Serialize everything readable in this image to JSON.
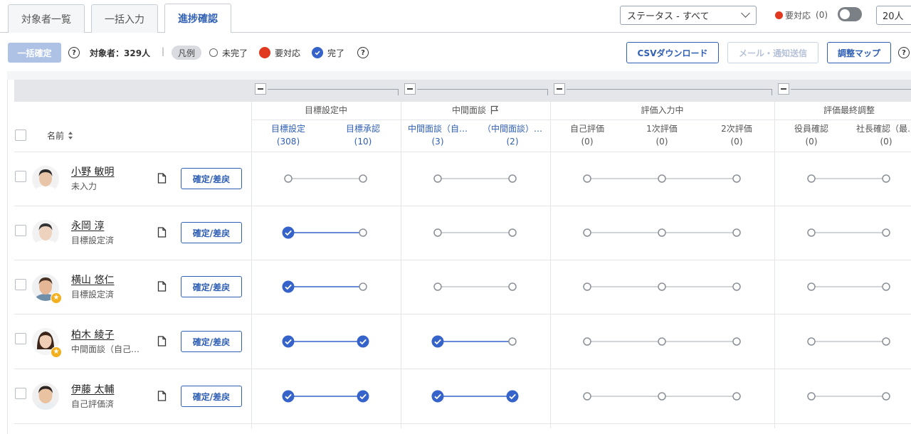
{
  "tabs": [
    {
      "label": "対象者一覧",
      "active": false
    },
    {
      "label": "一括入力",
      "active": false
    },
    {
      "label": "進捗確認",
      "active": true
    }
  ],
  "filters": {
    "status_select": "ステータス - すべて",
    "alert_label": "要対応",
    "alert_count": "(0)",
    "alert_toggle_on": false,
    "per_page": "20人"
  },
  "toolbar": {
    "bulk_confirm_label": "一括確定",
    "target_count": "対象者：329人",
    "separator": "|",
    "legend_label": "凡例",
    "legend_incomplete": "未完了",
    "legend_action": "要対応",
    "legend_done": "完了",
    "csv_label": "CSVダウンロード",
    "mail_label": "メール・通知送信",
    "adjust_map_label": "調整マップ",
    "help_glyph": "?"
  },
  "table": {
    "name_header": "名前",
    "groups": [
      {
        "label": "目標設定中",
        "flag": false
      },
      {
        "label": "中間面談",
        "flag": true
      },
      {
        "label": "評価入力中",
        "flag": false
      },
      {
        "label": "評価最終調整",
        "flag": false
      }
    ],
    "stages": [
      {
        "label": "目標設定",
        "count": "(308)",
        "link": true
      },
      {
        "label": "目標承認",
        "count": "(10)",
        "link": true
      },
      {
        "label": "中間面談（自…",
        "count": "(3)",
        "link": true
      },
      {
        "label": "（中間面談）…",
        "count": "(2)",
        "link": true
      },
      {
        "label": "自己評価",
        "count": "(0)",
        "link": false
      },
      {
        "label": "1次評価",
        "count": "(0)",
        "link": false
      },
      {
        "label": "2次評価",
        "count": "(0)",
        "link": false
      },
      {
        "label": "役員確認",
        "count": "(0)",
        "link": false
      },
      {
        "label": "社長確認（最…",
        "count": "(0)",
        "link": false
      }
    ],
    "confirm_button_label": "確定/差戻",
    "rows": [
      {
        "name": "小野 敏明",
        "status": "未入力",
        "star": false,
        "skin": "#e8c4a8",
        "hair": "#2a2a2a",
        "shirt": "#ffffff",
        "done": [
          false,
          false,
          false,
          false,
          false,
          false,
          false,
          false,
          false
        ]
      },
      {
        "name": "永岡 淳",
        "status": "目標設定済",
        "star": false,
        "skin": "#edd2bd",
        "hair": "#333333",
        "shirt": "#ffffff",
        "done": [
          true,
          false,
          false,
          false,
          false,
          false,
          false,
          false,
          false
        ]
      },
      {
        "name": "横山 悠仁",
        "status": "目標設定済",
        "star": true,
        "skin": "#e6b796",
        "hair": "#4a3222",
        "shirt": "#6f8fa8",
        "done": [
          true,
          false,
          false,
          false,
          false,
          false,
          false,
          false,
          false
        ]
      },
      {
        "name": "柏木 綾子",
        "status": "中間面談（自己…",
        "star": true,
        "skin": "#f0cdb5",
        "hair": "#3b2418",
        "shirt": "#f4f4f4",
        "done": [
          true,
          true,
          true,
          false,
          false,
          false,
          false,
          false,
          false
        ]
      },
      {
        "name": "伊藤 太輔",
        "status": "自己評価済",
        "star": false,
        "skin": "#e9c3a1",
        "hair": "#2e2420",
        "shirt": "#e9eef2",
        "done": [
          true,
          true,
          true,
          true,
          false,
          false,
          false,
          false,
          false
        ]
      }
    ]
  },
  "colors": {
    "accent": "#2f5fb3",
    "done": "#3563c9",
    "alert": "#e0391f",
    "open_node": "#8a8f98",
    "track_gray": "#c4c7cc",
    "track_blue": "#3563c9"
  }
}
